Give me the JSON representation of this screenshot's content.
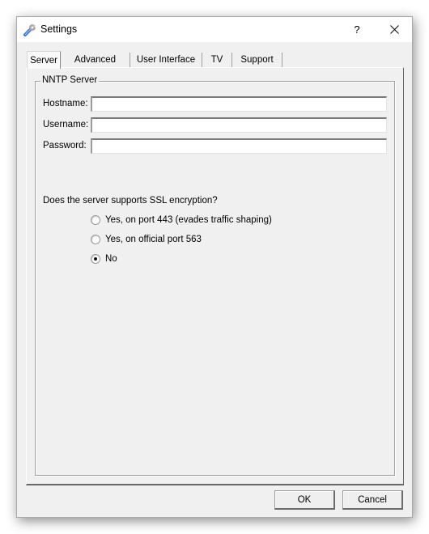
{
  "window": {
    "title": "Settings",
    "icon": "wrench-icon",
    "help_label": "?",
    "close_icon": "close-icon"
  },
  "tabs": [
    {
      "label": "Server",
      "active": true
    },
    {
      "label": "Advanced",
      "active": false
    },
    {
      "label": "User Interface",
      "active": false
    },
    {
      "label": "TV",
      "active": false
    },
    {
      "label": "Support",
      "active": false
    }
  ],
  "server": {
    "group_title": "NNTP Server",
    "fields": [
      {
        "label": "Hostname:",
        "value": "",
        "placeholder": ""
      },
      {
        "label": "Username:",
        "value": "",
        "placeholder": ""
      },
      {
        "label": "Password:",
        "value": "",
        "placeholder": ""
      }
    ],
    "ssl_question": "Does the server supports SSL encryption?",
    "ssl_options": [
      {
        "label": "Yes, on port 443 (evades traffic shaping)",
        "checked": false
      },
      {
        "label": "Yes, on official port 563",
        "checked": false
      },
      {
        "label": "No",
        "checked": true
      }
    ]
  },
  "buttons": {
    "ok_label": "OK",
    "cancel_label": "Cancel"
  }
}
